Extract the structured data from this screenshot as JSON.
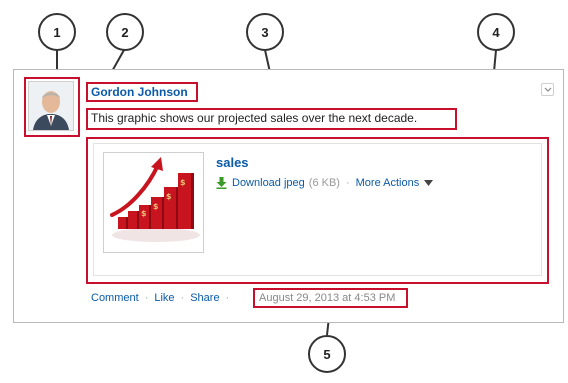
{
  "post": {
    "author": "Gordon Johnson",
    "body": "This graphic shows our projected sales over the next decade.",
    "attachment": {
      "title": "sales",
      "download_label": "Download jpeg",
      "file_size": "(6 KB)",
      "more_actions_label": "More Actions"
    },
    "actions": {
      "comment": "Comment",
      "like": "Like",
      "share": "Share"
    },
    "timestamp": "August 29, 2013 at 4:53 PM"
  },
  "callouts": [
    "1",
    "2",
    "3",
    "4",
    "5"
  ],
  "colors": {
    "highlight": "#c8102e",
    "link": "#0b5ba8"
  }
}
